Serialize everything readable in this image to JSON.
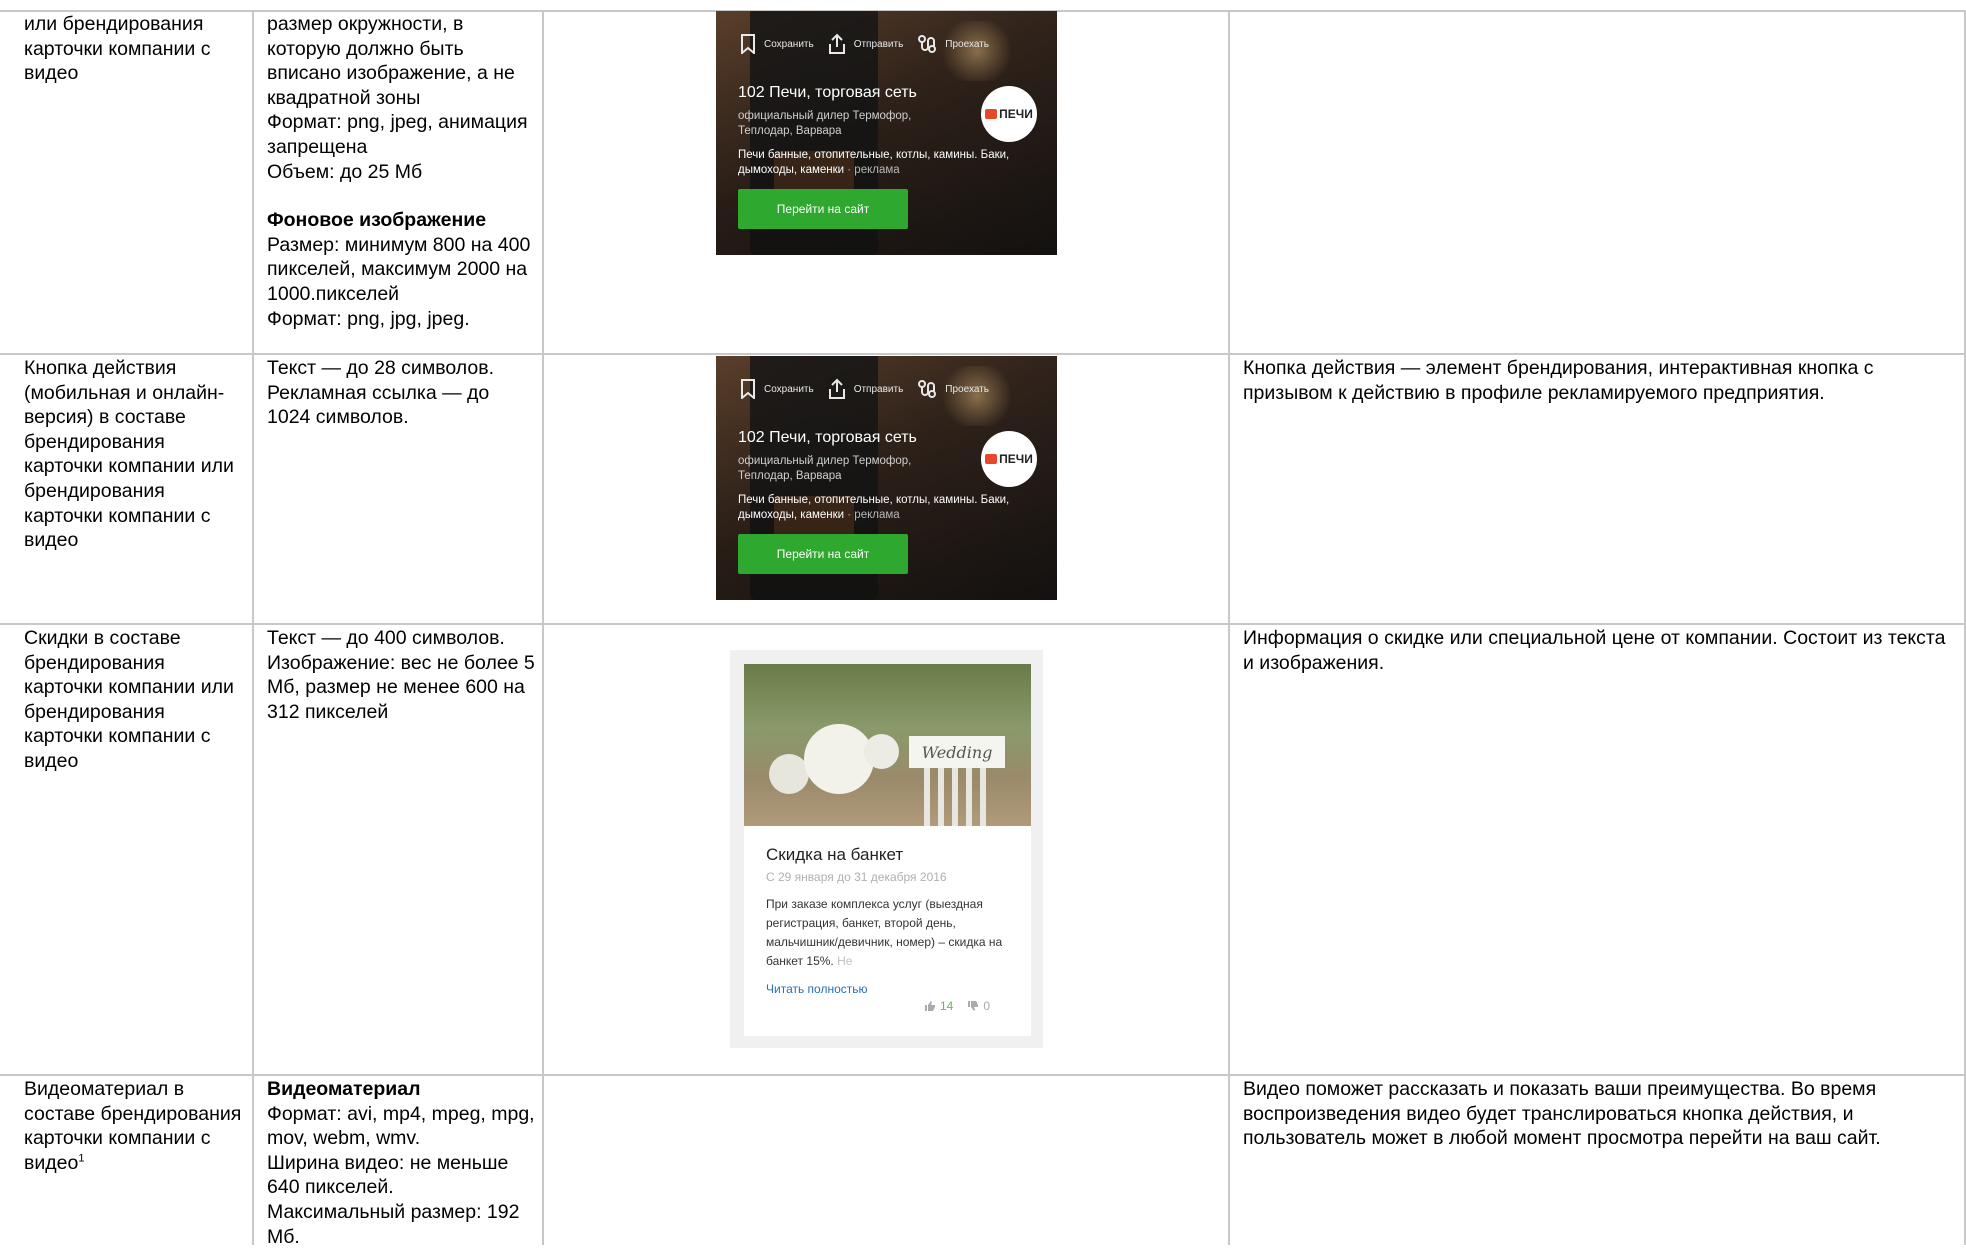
{
  "rows": [
    {
      "name": "или брендирования карточки компании с видео",
      "requirements": [
        "размер окружности, в которую должно быть вписано изображение, а не квадратной зоны",
        "Формат: png, jpeg, анимация запрещена",
        "Объем: до 25 Мб"
      ],
      "requirements_heading": "Фоновое изображение",
      "requirements_2": [
        "Размер: минимум 800 на 400 пикселей, максимум 2000 на 1000.пикселей",
        "Формат: png, jpg, jpeg."
      ],
      "description": ""
    },
    {
      "name": "Кнопка действия (мобильная и онлайн-версия) в составе брендирования карточки компании или брендирования карточки компании с видео",
      "requirements": [
        "Текст — до 28 символов.",
        "Рекламная ссылка — до 1024 символов."
      ],
      "description": "Кнопка действия — элемент брендирования, интерактивная кнопка с призывом к действию в профиле рекламируемого предприятия."
    },
    {
      "name": "Скидки в составе брендирования карточки компании или брендирования карточки компании с видео",
      "requirements": [
        "Текст — до 400 символов. Изображение: вес не более 5 Мб, размер не менее 600 на 312 пикселей"
      ],
      "description": "Информация о скидке или специальной цене от компании. Состоит из текста и изображения."
    },
    {
      "name": "Видеоматериал в составе брендирования карточки компании с видео",
      "name_sup": "1",
      "requirements_heading": "Видеоматериал",
      "requirements": [
        "Формат: avi, mp4, mpeg, mpg, mov, webm, wmv.",
        "Ширина видео: не меньше 640 пикселей.",
        "Максимальный размер: 192 Мб."
      ],
      "description": "Видео поможет рассказать и показать ваши преимущества. Во время воспроизведения видео будет транслироваться кнопка действия, и пользователь может в любой момент просмотра перейти на ваш сайт."
    }
  ],
  "ad_card": {
    "save": "Сохранить",
    "share": "Отправить",
    "route": "Проехать",
    "title": "102 Печи, торговая сеть",
    "subtitle": "официальный дилер Термофор, Теплодар, Варвара",
    "description": "Печи банные, отопительные, котлы, камины. Баки, дымоходы, каменки",
    "ad_mark": "· реклама",
    "button": "Перейти на сайт",
    "logo": "ПЕЧИ"
  },
  "discount_card": {
    "photo_sign": "Wedding",
    "title": "Скидка на банкет",
    "dates": "С 29 января до 31 декабря 2016",
    "text": "При заказе комплекса услуг (выездная регистрация, банкет, второй день, мальчишник/девичник, номер) – скидка на банкет 15%.",
    "text_fade": "Не",
    "read_more": "Читать полностью",
    "likes": "14",
    "dislikes": "0"
  },
  "colors": {
    "grid": "#c8c8c8",
    "ad_button": "#2ea82e",
    "logo_accent": "#e8472a",
    "link": "#2a6fb0",
    "likes": "#6bb84a"
  }
}
